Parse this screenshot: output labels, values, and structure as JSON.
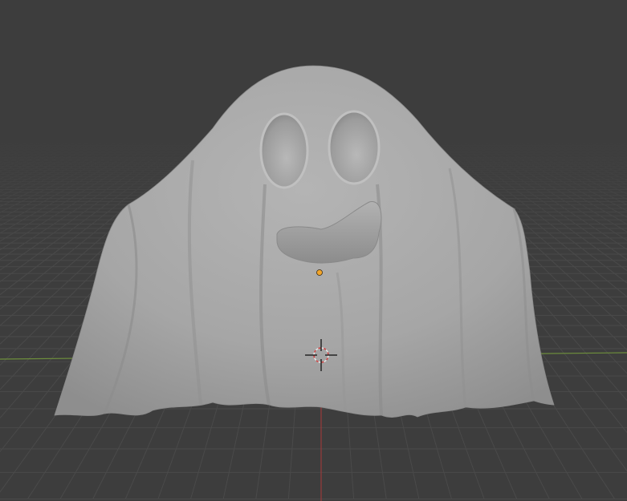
{
  "viewport": {
    "background": "#3d3d3d",
    "grid_color": "#4a4a4a",
    "axis_x_color": "#6e8f3c",
    "axis_y_color": "#9a3b3b",
    "origin_color": "#f2a52a",
    "mesh_color": "#a9a9a9"
  }
}
